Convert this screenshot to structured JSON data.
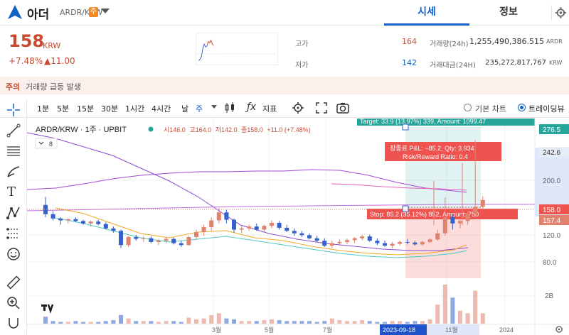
{
  "header": {
    "coin_name": "아더",
    "pair": "ARDR/KRW",
    "warning_badge": "주",
    "tabs": [
      {
        "label": "시세",
        "active": true
      },
      {
        "label": "정보",
        "active": false
      }
    ]
  },
  "price": {
    "value": "158",
    "unit": "KRW",
    "change_rate": "+7.48%",
    "change_amount": "▲11.00",
    "color": "#c84a31"
  },
  "stats": {
    "high_label": "고가",
    "high_value": "164",
    "low_label": "저가",
    "low_value": "142",
    "volume_label": "거래량(24h)",
    "volume_value": "1,255,490,386.515",
    "volume_unit": "ARDR",
    "amount_label": "거래대금(24H)",
    "amount_value": "235,272,817,767",
    "amount_unit": "KRW"
  },
  "notice": {
    "tag": "주의",
    "text": "거래량 급등 발생"
  },
  "toolbar": {
    "intervals": [
      "1분",
      "5분",
      "15분",
      "30분",
      "1시간",
      "4시간",
      "날",
      "주"
    ],
    "active_interval": "주",
    "indicators_label": "지표",
    "basic_chart_label": "기본 차트",
    "tradingview_label": "트레이딩뷰",
    "selected_mode": "트레이딩뷰"
  },
  "chart": {
    "symbol_title": "ARDR/KRW · 1주 · UPBIT",
    "ohlc_open_label": "시",
    "ohlc_open": "146.0",
    "ohlc_high_label": "고",
    "ohlc_high": "164.0",
    "ohlc_low_label": "저",
    "ohlc_low": "142.0",
    "ohlc_close_label": "종",
    "ohlc_close": "158.0",
    "ohlc_change": "+11.0 (+7.48%)",
    "indicator_count": "8",
    "target_label": "Target: 33.9 (13.97%) 339, Amount: 1099.47",
    "pnl_label": "장종료 P&L: −85.2, Qty: 3.934",
    "rr_label": "Risk/Reward Ratio: 0.4",
    "stop_label": "Stop: 85.2 (35.12%) 852, Amount: 750",
    "price_axis": [
      "276.5",
      "242.6",
      "200.0",
      "158.0",
      "157.4",
      "120.0",
      "80.0",
      "2B"
    ],
    "time_axis": [
      "3월",
      "5월",
      "7월",
      "2023-09-18",
      "11월",
      "2024"
    ],
    "colors": {
      "up": "#e0826e",
      "down": "#3561c9",
      "target": "#26a69a",
      "stop": "#ef5350"
    }
  },
  "chart_data": {
    "type": "candlestick",
    "title": "ARDR/KRW · 1주 · UPBIT",
    "ylim": [
      60,
      290
    ],
    "candles": [
      [
        150,
        163,
        130,
        135
      ],
      [
        135,
        140,
        125,
        128
      ],
      [
        128,
        130,
        118,
        125
      ],
      [
        125,
        128,
        120,
        127
      ],
      [
        127,
        130,
        122,
        124
      ],
      [
        124,
        126,
        118,
        120
      ],
      [
        120,
        125,
        115,
        123
      ],
      [
        123,
        126,
        117,
        119
      ],
      [
        119,
        122,
        110,
        112
      ],
      [
        112,
        115,
        105,
        108
      ],
      [
        108,
        110,
        80,
        85
      ],
      [
        85,
        100,
        82,
        98
      ],
      [
        98,
        102,
        92,
        95
      ],
      [
        95,
        100,
        90,
        96
      ],
      [
        96,
        99,
        88,
        90
      ],
      [
        90,
        95,
        85,
        92
      ],
      [
        92,
        98,
        88,
        95
      ],
      [
        95,
        97,
        86,
        88
      ],
      [
        88,
        92,
        82,
        85
      ],
      [
        85,
        100,
        84,
        98
      ],
      [
        98,
        110,
        95,
        106
      ],
      [
        106,
        118,
        100,
        114
      ],
      [
        114,
        130,
        108,
        125
      ],
      [
        125,
        145,
        120,
        138
      ],
      [
        138,
        142,
        120,
        126
      ],
      [
        126,
        128,
        105,
        110
      ],
      [
        110,
        116,
        104,
        112
      ],
      [
        112,
        118,
        108,
        115
      ],
      [
        115,
        120,
        108,
        110
      ],
      [
        110,
        118,
        106,
        116
      ],
      [
        116,
        125,
        112,
        121
      ],
      [
        121,
        124,
        110,
        113
      ],
      [
        113,
        118,
        106,
        108
      ],
      [
        108,
        112,
        100,
        104
      ],
      [
        104,
        108,
        98,
        101
      ],
      [
        101,
        104,
        94,
        96
      ],
      [
        96,
        100,
        90,
        92
      ],
      [
        92,
        96,
        82,
        84
      ],
      [
        84,
        92,
        80,
        88
      ],
      [
        88,
        94,
        84,
        90
      ],
      [
        90,
        96,
        86,
        93
      ],
      [
        93,
        98,
        88,
        96
      ],
      [
        96,
        102,
        92,
        99
      ],
      [
        99,
        102,
        90,
        92
      ],
      [
        92,
        96,
        85,
        88
      ],
      [
        88,
        92,
        82,
        84
      ],
      [
        84,
        90,
        80,
        87
      ],
      [
        87,
        92,
        84,
        90
      ],
      [
        90,
        95,
        86,
        89
      ],
      [
        89,
        92,
        84,
        86
      ],
      [
        86,
        92,
        84,
        90
      ],
      [
        90,
        96,
        88,
        94
      ],
      [
        94,
        110,
        92,
        104
      ],
      [
        104,
        162,
        100,
        130
      ],
      [
        130,
        135,
        110,
        120
      ],
      [
        120,
        126,
        112,
        124
      ],
      [
        124,
        140,
        118,
        136
      ],
      [
        136,
        255,
        130,
        147
      ],
      [
        147,
        164,
        142,
        158
      ]
    ],
    "volume": [
      8,
      3,
      2,
      2,
      3,
      2,
      2,
      2,
      3,
      4,
      10,
      6,
      3,
      3,
      3,
      2,
      3,
      3,
      2,
      7,
      5,
      6,
      10,
      12,
      6,
      5,
      3,
      3,
      3,
      4,
      5,
      4,
      3,
      3,
      3,
      3,
      2,
      3,
      6,
      4,
      3,
      3,
      4,
      3,
      2,
      2,
      3,
      3,
      2,
      3,
      3,
      5,
      22,
      45,
      30,
      15,
      12,
      38,
      12
    ]
  }
}
